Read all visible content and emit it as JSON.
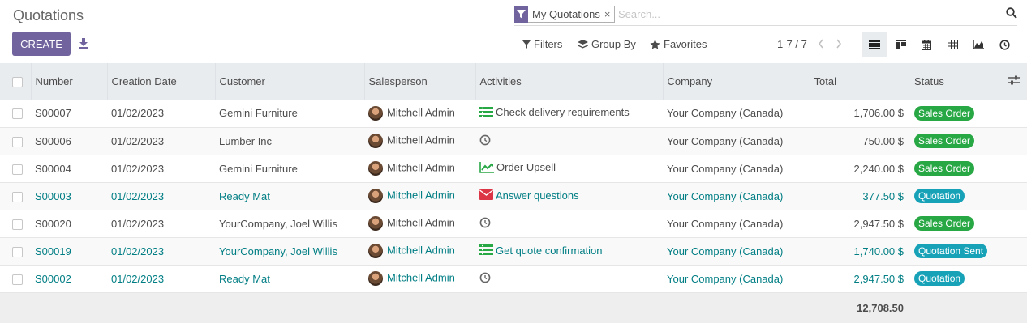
{
  "header": {
    "title": "Quotations",
    "create_label": "CREATE"
  },
  "search": {
    "facet_label": "My Quotations",
    "facet_close": "×",
    "placeholder": "Search..."
  },
  "toolbar": {
    "filters_label": "Filters",
    "groupby_label": "Group By",
    "favorites_label": "Favorites",
    "pager": "1-7 / 7"
  },
  "columns": {
    "number": "Number",
    "creation_date": "Creation Date",
    "customer": "Customer",
    "salesperson": "Salesperson",
    "activities": "Activities",
    "company": "Company",
    "total": "Total",
    "status": "Status"
  },
  "rows": [
    {
      "number": "S00007",
      "date": "01/02/2023",
      "customer": "Gemini Furniture",
      "salesperson": "Mitchell Admin",
      "activity_icon": "list-icon",
      "activity": "Check delivery requirements",
      "company": "Your Company (Canada)",
      "total": "1,706.00 $",
      "status": "Sales Order",
      "status_color": "#28a745"
    },
    {
      "number": "S00006",
      "date": "01/02/2023",
      "customer": "Lumber Inc",
      "salesperson": "Mitchell Admin",
      "activity_icon": "clock-icon",
      "activity": "",
      "company": "Your Company (Canada)",
      "total": "750.00 $",
      "status": "Sales Order",
      "status_color": "#28a745"
    },
    {
      "number": "S00004",
      "date": "01/02/2023",
      "customer": "Gemini Furniture",
      "salesperson": "Mitchell Admin",
      "activity_icon": "chart-icon",
      "activity": "Order Upsell",
      "company": "Your Company (Canada)",
      "total": "2,240.00 $",
      "status": "Sales Order",
      "status_color": "#28a745"
    },
    {
      "number": "S00003",
      "date": "01/02/2023",
      "customer": "Ready Mat",
      "salesperson": "Mitchell Admin",
      "activity_icon": "envelope-icon",
      "activity": "Answer questions",
      "company": "Your Company (Canada)",
      "total": "377.50 $",
      "status": "Quotation",
      "status_color": "#17a2b8"
    },
    {
      "number": "S00020",
      "date": "01/02/2023",
      "customer": "YourCompany, Joel Willis",
      "salesperson": "Mitchell Admin",
      "activity_icon": "clock-icon",
      "activity": "",
      "company": "Your Company (Canada)",
      "total": "2,947.50 $",
      "status": "Sales Order",
      "status_color": "#28a745"
    },
    {
      "number": "S00019",
      "date": "01/02/2023",
      "customer": "YourCompany, Joel Willis",
      "salesperson": "Mitchell Admin",
      "activity_icon": "list-icon",
      "activity": "Get quote confirmation",
      "company": "Your Company (Canada)",
      "total": "1,740.00 $",
      "status": "Quotation Sent",
      "status_color": "#17a2b8"
    },
    {
      "number": "S00002",
      "date": "01/02/2023",
      "customer": "Ready Mat",
      "salesperson": "Mitchell Admin",
      "activity_icon": "clock-icon",
      "activity": "",
      "company": "Your Company (Canada)",
      "total": "2,947.50 $",
      "status": "Quotation",
      "status_color": "#17a2b8"
    }
  ],
  "footer": {
    "total": "12,708.50"
  }
}
